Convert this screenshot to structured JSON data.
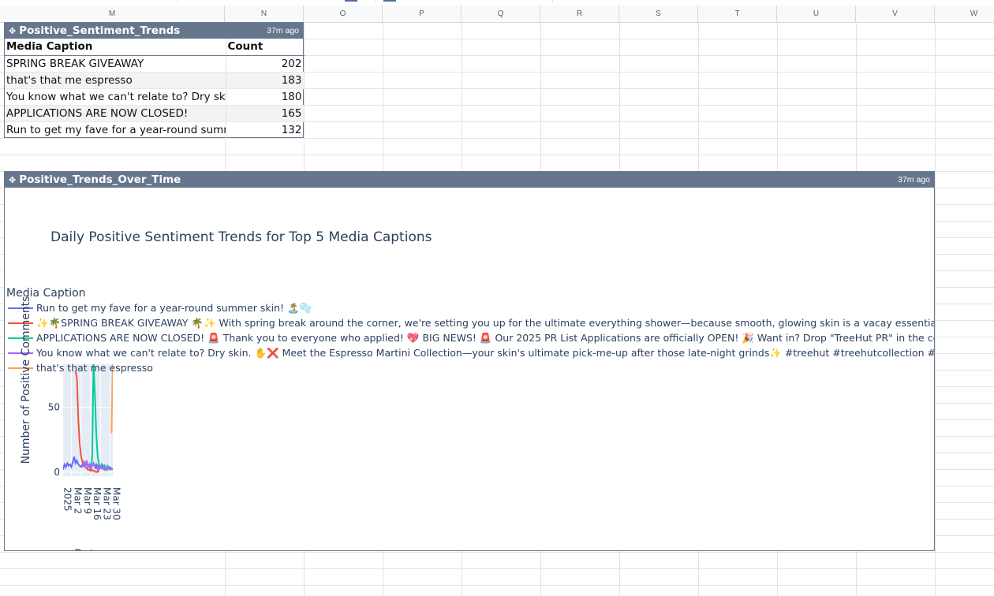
{
  "columns": [
    "M",
    "N",
    "O",
    "P",
    "Q",
    "R",
    "S",
    "T",
    "U",
    "V",
    "W"
  ],
  "table_widget": {
    "title": "Positive_Sentiment_Trends",
    "updated": "37m ago",
    "headers": [
      "Media Caption",
      "Count"
    ],
    "rows": [
      {
        "caption": "SPRING BREAK GIVEAWAY",
        "count": "202"
      },
      {
        "caption": "that's that me espresso",
        "count": "183"
      },
      {
        "caption": "You know what we can't relate to? Dry skin",
        "count": "180"
      },
      {
        "caption": "APPLICATIONS ARE NOW CLOSED!",
        "count": "165"
      },
      {
        "caption": "Run to get my fave for a year-round summ",
        "count": "132"
      }
    ]
  },
  "chart_widget": {
    "title": "Positive_Trends_Over_Time",
    "updated": "37m ago"
  },
  "colors": {
    "header_bar": "#66768c",
    "plot_bg": "#e5ecf6",
    "series_1": "#636efa",
    "series_2": "#ef553b",
    "series_3": "#00cc96",
    "series_4": "#ab63fa",
    "series_5": "#ffa15a"
  },
  "chart_data": {
    "type": "line",
    "title": "Daily Positive Sentiment Trends for Top 5 Media Captions",
    "xlabel": "Date",
    "ylabel": "Number of Positive Comments",
    "legend_title": "Media Caption",
    "legend_position": "top-left",
    "grid": true,
    "x_ticks": [
      "Mar 2\n2025",
      "Mar 9",
      "Mar 16",
      "Mar 23",
      "Mar 30"
    ],
    "x_tick_dates": [
      "2025-03-02",
      "2025-03-09",
      "2025-03-16",
      "2025-03-23",
      "2025-03-30"
    ],
    "y_ticks": [
      "0",
      "50"
    ],
    "ylim": [
      -3,
      83
    ],
    "xlim": [
      "2025-02-24",
      "2025-04-01"
    ],
    "series": [
      {
        "name": "Run to get my fave for a year-round summer skin! 🏝️🫧",
        "color": "#636efa",
        "points": [
          [
            "2025-02-24",
            2
          ],
          [
            "2025-02-25",
            6
          ],
          [
            "2025-02-26",
            4
          ],
          [
            "2025-02-27",
            7
          ],
          [
            "2025-02-28",
            5
          ],
          [
            "2025-03-01",
            6
          ],
          [
            "2025-03-02",
            4
          ],
          [
            "2025-03-03",
            8
          ],
          [
            "2025-03-04",
            12
          ],
          [
            "2025-03-05",
            7
          ],
          [
            "2025-03-06",
            9
          ],
          [
            "2025-03-07",
            6
          ],
          [
            "2025-03-08",
            5
          ],
          [
            "2025-03-09",
            4
          ],
          [
            "2025-03-10",
            6
          ],
          [
            "2025-03-11",
            8
          ],
          [
            "2025-03-12",
            5
          ],
          [
            "2025-03-13",
            7
          ],
          [
            "2025-03-14",
            4
          ],
          [
            "2025-03-15",
            6
          ],
          [
            "2025-03-16",
            3
          ],
          [
            "2025-03-17",
            5
          ],
          [
            "2025-03-18",
            7
          ],
          [
            "2025-03-19",
            4
          ],
          [
            "2025-03-20",
            6
          ],
          [
            "2025-03-21",
            3
          ],
          [
            "2025-03-22",
            5
          ],
          [
            "2025-03-23",
            4
          ],
          [
            "2025-03-24",
            6
          ],
          [
            "2025-03-25",
            3
          ],
          [
            "2025-03-26",
            5
          ],
          [
            "2025-03-27",
            2
          ],
          [
            "2025-03-28",
            4
          ],
          [
            "2025-03-29",
            3
          ],
          [
            "2025-03-30",
            2
          ],
          [
            "2025-03-31",
            3
          ],
          [
            "2025-04-01",
            2
          ]
        ]
      },
      {
        "name": "✨🌴SPRING BREAK GIVEAWAY 🌴✨  With spring break around the corner, we're setting you up for the ultimate everything shower—because smooth, glowing skin is a vacay essential! ☀️",
        "color": "#ef553b",
        "points": [
          [
            "2025-03-05",
            78
          ],
          [
            "2025-03-06",
            72
          ],
          [
            "2025-03-07",
            40
          ],
          [
            "2025-03-08",
            22
          ],
          [
            "2025-03-09",
            12
          ],
          [
            "2025-03-10",
            8
          ],
          [
            "2025-03-11",
            5
          ],
          [
            "2025-03-12",
            4
          ],
          [
            "2025-03-13",
            3
          ],
          [
            "2025-03-14",
            2
          ],
          [
            "2025-03-15",
            2
          ],
          [
            "2025-03-16",
            1
          ],
          [
            "2025-03-17",
            2
          ],
          [
            "2025-03-18",
            1
          ],
          [
            "2025-03-19",
            1
          ],
          [
            "2025-03-20",
            0
          ],
          [
            "2025-03-21",
            1
          ],
          [
            "2025-03-22",
            0
          ]
        ]
      },
      {
        "name": "APPLICATIONS ARE NOW CLOSED! 🚨  Thank you to everyone who applied! 💖  BIG NEWS! 🚨  Our 2025 PR List Applications are officially OPEN! 🎉 Want in? Drop \"TreeHut PR\" in the com",
        "color": "#00cc96",
        "points": [
          [
            "2025-03-15",
            3
          ],
          [
            "2025-03-16",
            5
          ],
          [
            "2025-03-17",
            10
          ],
          [
            "2025-03-18",
            83
          ],
          [
            "2025-03-19",
            60
          ],
          [
            "2025-03-20",
            30
          ],
          [
            "2025-03-21",
            12
          ],
          [
            "2025-03-22",
            6
          ],
          [
            "2025-03-23",
            4
          ],
          [
            "2025-03-24",
            6
          ],
          [
            "2025-03-25",
            3
          ],
          [
            "2025-03-26",
            4
          ],
          [
            "2025-03-27",
            2
          ],
          [
            "2025-03-28",
            5
          ],
          [
            "2025-03-29",
            3
          ],
          [
            "2025-03-30",
            4
          ],
          [
            "2025-03-31",
            2
          ]
        ]
      },
      {
        "name": "You know what we can't relate to? Dry skin. ✋❌  Meet the Espresso Martini Collection—your skin's ultimate pick-me-up after those late-night grinds✨  #treehut #treehutcollection #selfca",
        "color": "#ab63fa",
        "points": [
          [
            "2025-03-10",
            4
          ],
          [
            "2025-03-11",
            7
          ],
          [
            "2025-03-12",
            5
          ],
          [
            "2025-03-13",
            9
          ],
          [
            "2025-03-14",
            4
          ],
          [
            "2025-03-15",
            6
          ],
          [
            "2025-03-16",
            3
          ],
          [
            "2025-03-17",
            5
          ],
          [
            "2025-03-18",
            7
          ],
          [
            "2025-03-19",
            4
          ],
          [
            "2025-03-20",
            3
          ],
          [
            "2025-03-21",
            5
          ],
          [
            "2025-03-22",
            2
          ],
          [
            "2025-03-23",
            4
          ],
          [
            "2025-03-24",
            3
          ],
          [
            "2025-03-25",
            5
          ],
          [
            "2025-03-26",
            2
          ],
          [
            "2025-03-27",
            3
          ],
          [
            "2025-03-28",
            2
          ],
          [
            "2025-03-29",
            4
          ],
          [
            "2025-03-30",
            3
          ],
          [
            "2025-03-31",
            2
          ]
        ]
      },
      {
        "name": "that's that me espresso",
        "color": "#ffa15a",
        "points": [
          [
            "2025-03-31",
            30
          ],
          [
            "2025-04-01",
            83
          ]
        ]
      }
    ]
  }
}
